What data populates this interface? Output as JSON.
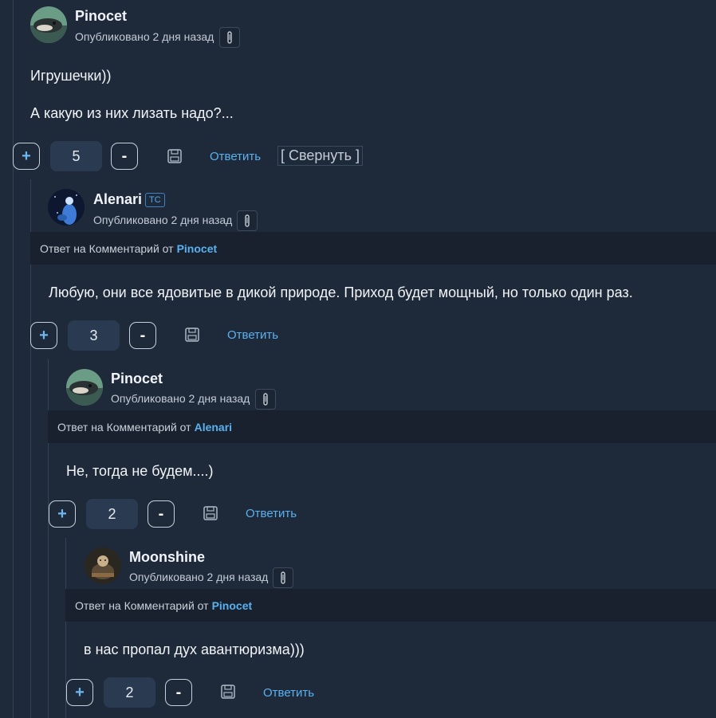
{
  "comments": [
    {
      "author": "Pinocet",
      "meta": "Опубликовано 2 дня назад",
      "lines": [
        "Игрушечки))",
        "А какую из них лизать надо?..."
      ],
      "score": "5",
      "reply_label": "Ответить",
      "collapse_label": "[ Свернуть ]"
    },
    {
      "author": "Alenari",
      "badge": "ТС",
      "meta": "Опубликовано 2 дня назад",
      "reply_to_prefix": "Ответ на Комментарий от",
      "reply_to_author": "Pinocet",
      "lines": [
        "Любую, они все ядовитые в дикой природе. Приход будет мощный, но только один раз."
      ],
      "score": "3",
      "reply_label": "Ответить"
    },
    {
      "author": "Pinocet",
      "meta": "Опубликовано 2 дня назад",
      "reply_to_prefix": "Ответ на Комментарий от",
      "reply_to_author": "Alenari",
      "lines": [
        "Не, тогда не будем....)"
      ],
      "score": "2",
      "reply_label": "Ответить"
    },
    {
      "author": "Moonshine",
      "meta": "Опубликовано 2 дня назад",
      "reply_to_prefix": "Ответ на Комментарий от",
      "reply_to_author": "Pinocet",
      "lines": [
        "в нас пропал дух авантюризма)))"
      ],
      "score": "2",
      "reply_label": "Ответить"
    }
  ],
  "vote": {
    "plus": "+",
    "minus": "-"
  },
  "colors": {
    "background": "#1e2a3a",
    "accent": "#5ab1f0",
    "reply_bar": "#18212d",
    "score_bg": "#2a3b51"
  },
  "icons": {
    "save": "save-icon",
    "pin": "pin-icon"
  }
}
